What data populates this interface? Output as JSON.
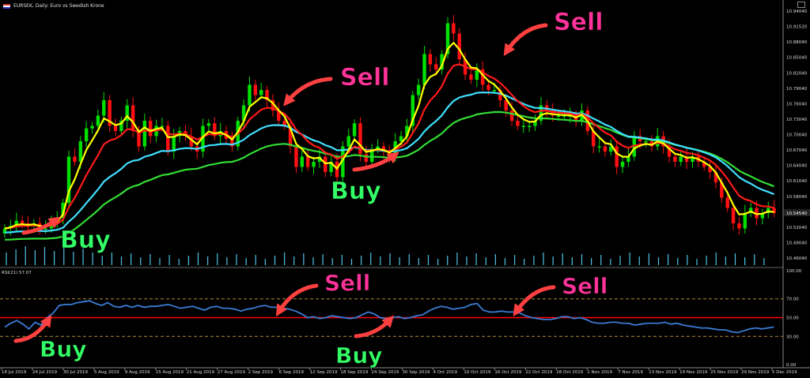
{
  "header": {
    "title": "EURSEK, Daily: Euro vs Swedish Krone"
  },
  "rsi_header": "RSI(21) 57.07",
  "annotations": {
    "price_buy_1": "Buy",
    "price_buy_2": "Buy",
    "price_sell_1": "Sell",
    "price_sell_2": "Sell",
    "rsi_buy_1": "Buy",
    "rsi_buy_2": "Buy",
    "rsi_sell_1": "Sell",
    "rsi_sell_2": "Sell"
  },
  "colors": {
    "buy_text": "#33ff66",
    "sell_text": "#ff3399",
    "arrow": "#ff4040",
    "bull_candle": "#00e000",
    "bear_candle": "#ff1010",
    "ma_yellow": "#ffff00",
    "ma_red": "#ff1a1a",
    "ma_cyan": "#40e0ff",
    "ma_green": "#33dd33",
    "rsi_line": "#3a7bd5",
    "rsi_mid": "#ff0000",
    "volume": "#4fc3e8"
  },
  "chart_data": [
    {
      "type": "candlestick",
      "ylim": [
        10.45,
        10.95
      ],
      "y_ticks": [
        "10.94040",
        "10.91520",
        "10.88040",
        "10.85040",
        "10.82040",
        "10.79040",
        "10.76040",
        "10.73040",
        "10.70040",
        "10.67040",
        "10.64040",
        "10.61040",
        "10.58040",
        "10.55040",
        "10.52040",
        "10.49040",
        "10.46040"
      ],
      "x_ticks": [
        "18 Jul 2019",
        "24 Jul 2019",
        "30 Jul 2019",
        "5 Aug 2019",
        "9 Aug 2019",
        "15 Aug 2019",
        "21 Aug 2019",
        "27 Aug 2019",
        "2 Sep 2019",
        "6 Sep 2019",
        "12 Sep 2019",
        "18 Sep 2019",
        "24 Sep 2019",
        "30 Sep 2019",
        "4 Oct 2019",
        "10 Oct 2019",
        "16 Oct 2019",
        "22 Oct 2019",
        "28 Oct 2019",
        "1 Nov 2019",
        "7 Nov 2019",
        "13 Nov 2019",
        "19 Nov 2019",
        "25 Nov 2019",
        "29 Nov 2019",
        "5 Dec 2019"
      ],
      "last_label": "10.54540",
      "closes": [
        10.52,
        10.525,
        10.535,
        10.53,
        10.525,
        10.53,
        10.52,
        10.52,
        10.535,
        10.54,
        10.57,
        10.66,
        10.65,
        10.69,
        10.715,
        10.72,
        10.74,
        10.77,
        10.72,
        10.71,
        10.73,
        10.76,
        10.71,
        10.68,
        10.73,
        10.7,
        10.72,
        10.72,
        10.67,
        10.7,
        10.71,
        10.7,
        10.68,
        10.67,
        10.72,
        10.725,
        10.7,
        10.71,
        10.695,
        10.68,
        10.73,
        10.76,
        10.8,
        10.78,
        10.79,
        10.77,
        10.75,
        10.73,
        10.72,
        10.68,
        10.64,
        10.66,
        10.64,
        10.65,
        10.66,
        10.63,
        10.65,
        10.62,
        10.68,
        10.7,
        10.725,
        10.665,
        10.65,
        10.675,
        10.68,
        10.67,
        10.66,
        10.69,
        10.7,
        10.72,
        10.78,
        10.8,
        10.86,
        10.84,
        10.83,
        10.86,
        10.92,
        10.9,
        10.85,
        10.82,
        10.81,
        10.83,
        10.8,
        10.79,
        10.79,
        10.77,
        10.75,
        10.73,
        10.72,
        10.72,
        10.72,
        10.73,
        10.76,
        10.75,
        10.74,
        10.74,
        10.74,
        10.74,
        10.73,
        10.75,
        10.71,
        10.68,
        10.68,
        10.67,
        10.68,
        10.64,
        10.65,
        10.66,
        10.7,
        10.69,
        10.69,
        10.68,
        10.7,
        10.68,
        10.66,
        10.65,
        10.66,
        10.65,
        10.66,
        10.65,
        10.64,
        10.63,
        10.61,
        10.58,
        10.56,
        10.53,
        10.52,
        10.55,
        10.56,
        10.54,
        10.55,
        10.56,
        10.55
      ],
      "volume_bars": 80
    },
    {
      "type": "line",
      "name": "RSI(21)",
      "ylim": [
        0,
        100
      ],
      "y_ticks": [
        "100.00",
        "70.00",
        "50.00",
        "30.00",
        "0.00"
      ],
      "levels": [
        70,
        50,
        30
      ],
      "values": [
        40,
        44,
        47,
        43,
        38,
        45,
        42,
        50,
        55,
        63,
        64,
        64,
        66,
        67,
        68,
        65,
        63,
        66,
        62,
        61,
        63,
        61,
        63,
        61,
        62,
        62,
        63,
        64,
        62,
        60,
        61,
        62,
        60,
        58,
        61,
        62,
        60,
        60,
        59,
        57,
        59,
        60,
        62,
        63,
        61,
        61,
        60,
        59,
        57,
        54,
        50,
        51,
        49,
        50,
        52,
        51,
        50,
        49,
        50,
        53,
        56,
        54,
        50,
        49,
        50,
        51,
        49,
        50,
        52,
        53,
        57,
        60,
        62,
        61,
        59,
        60,
        61,
        64,
        65,
        58,
        56,
        56,
        57,
        56,
        56,
        55,
        52,
        50,
        49,
        48,
        48,
        49,
        51,
        51,
        49,
        50,
        48,
        45,
        44,
        44,
        45,
        45,
        44,
        44,
        42,
        43,
        44,
        44,
        44,
        45,
        43,
        44,
        42,
        41,
        40,
        39,
        39,
        38,
        37,
        37,
        35,
        34,
        36,
        38,
        39,
        38,
        39,
        40
      ]
    }
  ]
}
